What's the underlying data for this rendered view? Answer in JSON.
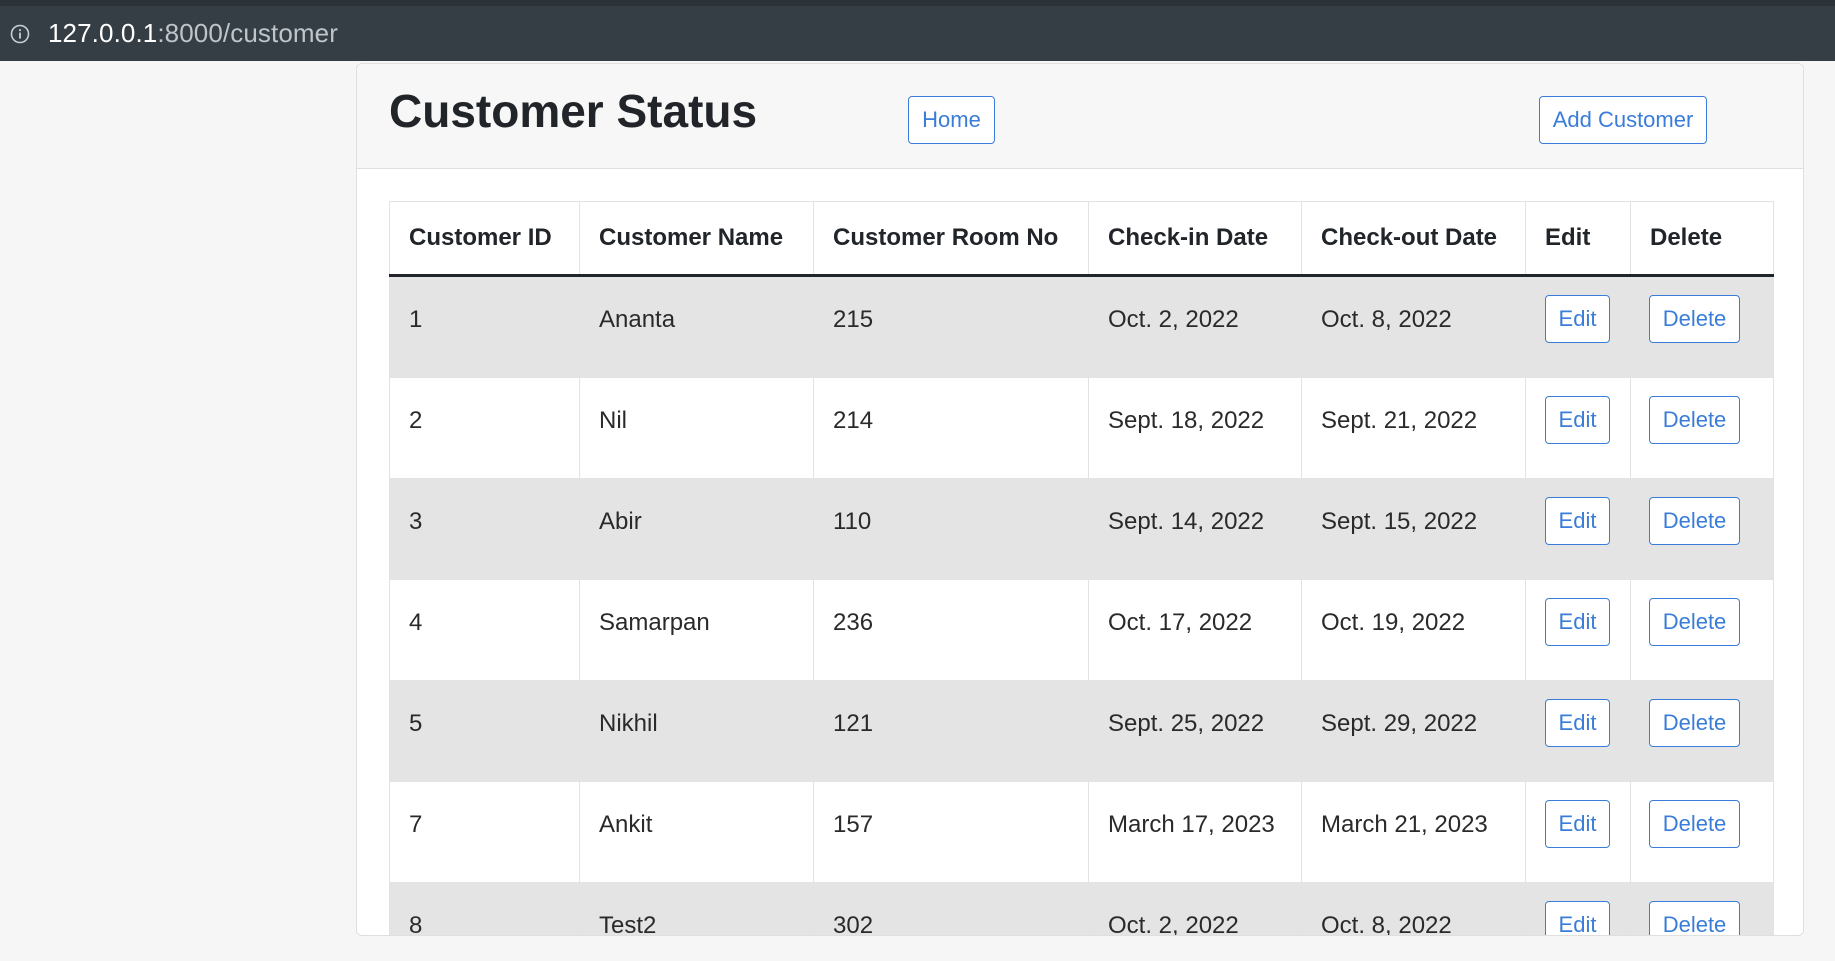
{
  "browser": {
    "url_host": "127.0.0.1",
    "url_rest": ":8000/customer",
    "info_icon": "info-icon"
  },
  "header": {
    "title": "Customer Status",
    "home_label": "Home",
    "add_label": "Add Customer"
  },
  "table": {
    "columns": [
      "Customer ID",
      "Customer Name",
      "Customer Room No",
      "Check-in Date",
      "Check-out Date",
      "Edit",
      "Delete"
    ],
    "rows": [
      {
        "id": "1",
        "name": "Ananta",
        "room": "215",
        "checkin": "Oct. 2, 2022",
        "checkout": "Oct. 8, 2022",
        "edit": "Edit",
        "delete": "Delete"
      },
      {
        "id": "2",
        "name": "Nil",
        "room": "214",
        "checkin": "Sept. 18, 2022",
        "checkout": "Sept. 21, 2022",
        "edit": "Edit",
        "delete": "Delete"
      },
      {
        "id": "3",
        "name": "Abir",
        "room": "110",
        "checkin": "Sept. 14, 2022",
        "checkout": "Sept. 15, 2022",
        "edit": "Edit",
        "delete": "Delete"
      },
      {
        "id": "4",
        "name": "Samarpan",
        "room": "236",
        "checkin": "Oct. 17, 2022",
        "checkout": "Oct. 19, 2022",
        "edit": "Edit",
        "delete": "Delete"
      },
      {
        "id": "5",
        "name": "Nikhil",
        "room": "121",
        "checkin": "Sept. 25, 2022",
        "checkout": "Sept. 29, 2022",
        "edit": "Edit",
        "delete": "Delete"
      },
      {
        "id": "7",
        "name": "Ankit",
        "room": "157",
        "checkin": "March 17, 2023",
        "checkout": "March 21, 2023",
        "edit": "Edit",
        "delete": "Delete"
      },
      {
        "id": "8",
        "name": "Test2",
        "room": "302",
        "checkin": "Oct. 2, 2022",
        "checkout": "Oct. 8, 2022",
        "edit": "Edit",
        "delete": "Delete"
      }
    ]
  },
  "colors": {
    "accent": "#3a7dd8",
    "address_bar": "#353e45",
    "row_stripe": "#e4e4e4"
  }
}
